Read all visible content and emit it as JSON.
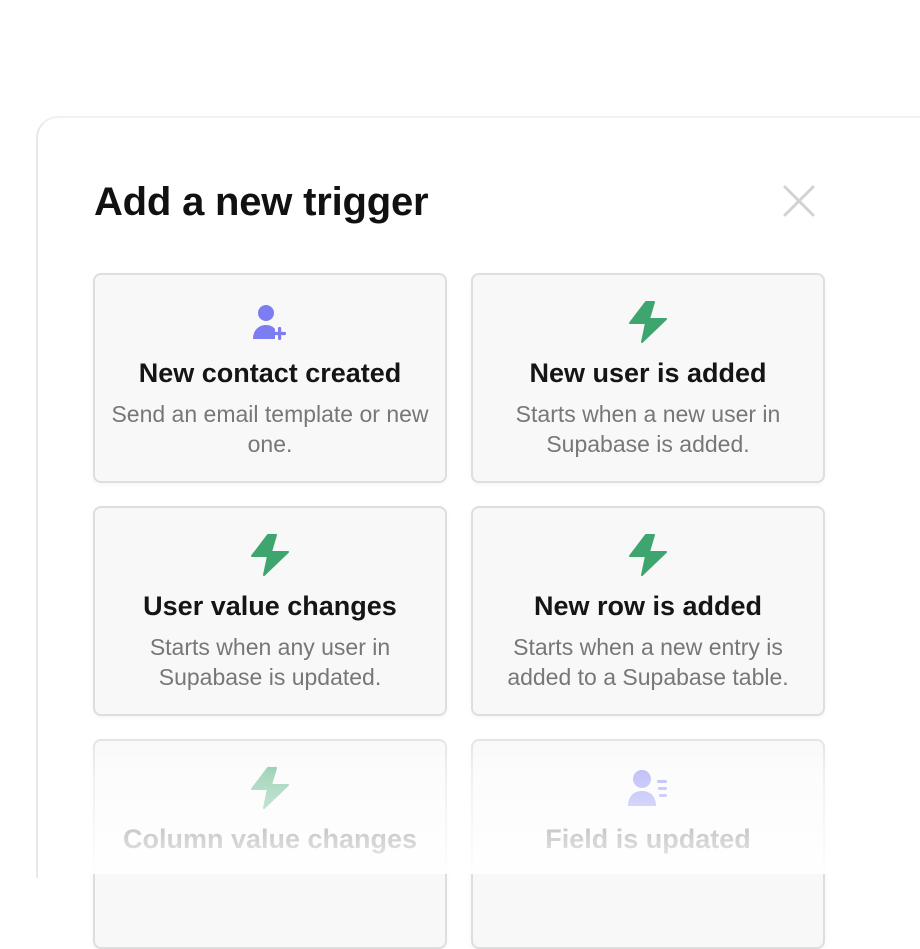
{
  "dialog": {
    "title": "Add a new trigger",
    "close_icon": "close-icon"
  },
  "colors": {
    "bolt_green": "#3fa56e",
    "user_purple": "#7b7df0"
  },
  "triggers": [
    {
      "icon": "user-add-icon",
      "title": "New contact created",
      "description": "Send an email template or new one."
    },
    {
      "icon": "bolt-icon",
      "title": "New user is added",
      "description": "Starts when a new user in Supabase is added."
    },
    {
      "icon": "bolt-icon",
      "title": "User value changes",
      "description": "Starts when any user in Supabase is updated."
    },
    {
      "icon": "bolt-icon",
      "title": "New row is added",
      "description": "Starts when a new entry is added to a Supabase table."
    },
    {
      "icon": "bolt-icon",
      "title": "Column value changes",
      "description": ""
    },
    {
      "icon": "user-list-icon",
      "title": "Field is updated",
      "description": ""
    }
  ]
}
